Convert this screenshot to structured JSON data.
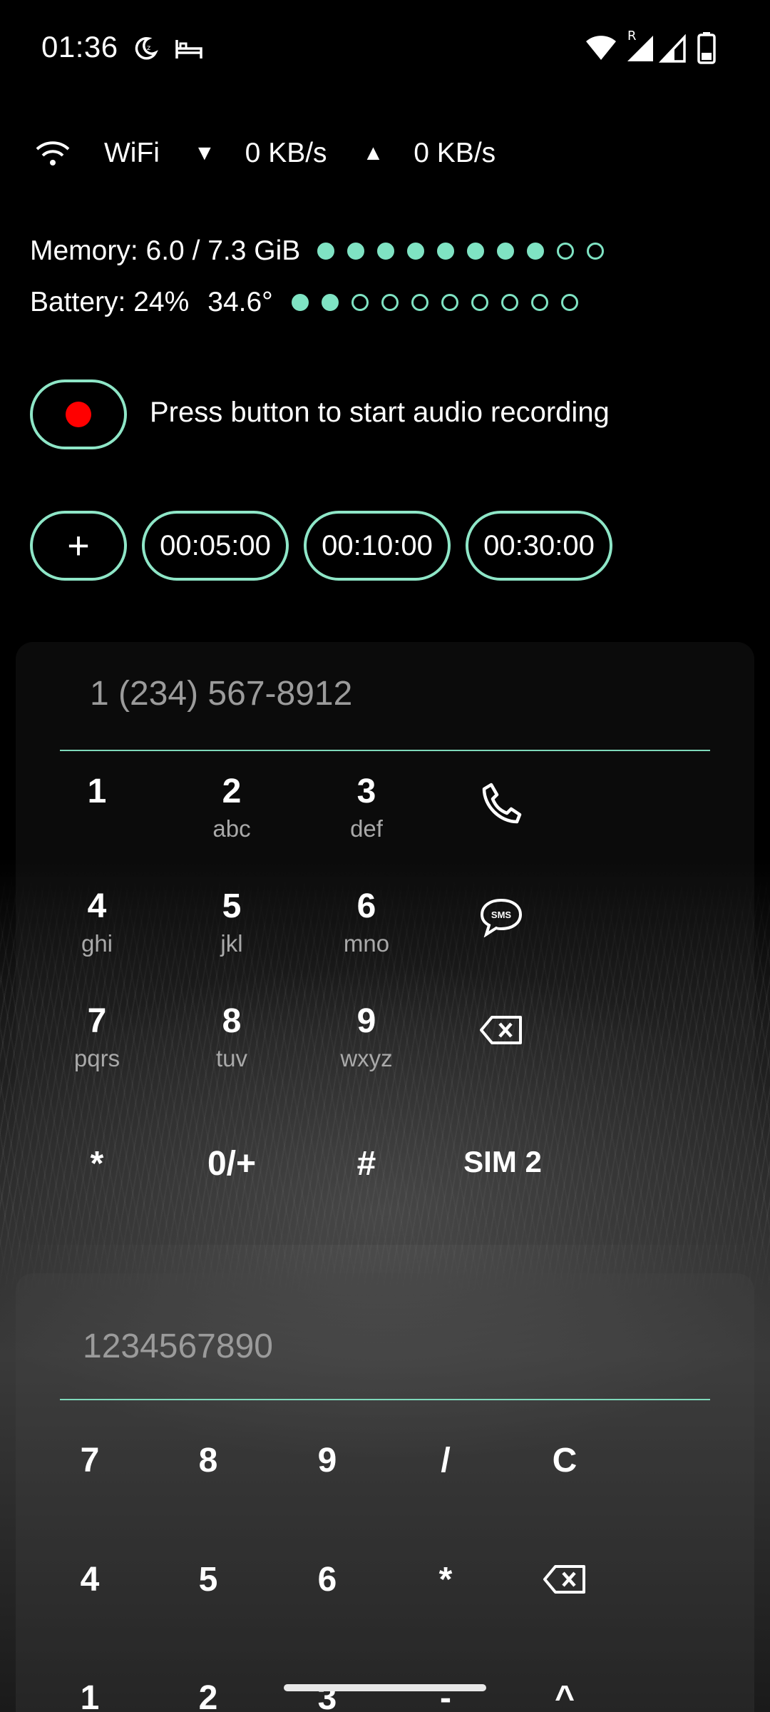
{
  "status_bar": {
    "time": "01:36",
    "roaming_indicator": "R",
    "icons": [
      "do-not-disturb-moon-icon",
      "sleep-bed-icon",
      "wifi-icon",
      "signal-roaming-icon",
      "signal-icon",
      "battery-icon"
    ]
  },
  "network": {
    "label": "WiFi",
    "down_arrow": "▼",
    "down_speed": "0 KB/s",
    "up_arrow": "▲",
    "up_speed": "0 KB/s"
  },
  "memory": {
    "text": "Memory: 6.0 / 7.3 GiB",
    "dots_filled": 8,
    "dots_total": 10
  },
  "battery": {
    "text": "Battery: 24%",
    "temperature": "34.6°",
    "dots_filled": 2,
    "dots_total": 10
  },
  "recorder": {
    "hint": "Press button to start audio recording"
  },
  "timers": {
    "add_label": "+",
    "presets": [
      "00:05:00",
      "00:10:00",
      "00:30:00"
    ]
  },
  "dialer": {
    "placeholder": "1 (234) 567-8912",
    "keys": [
      {
        "digit": "1",
        "letters": ""
      },
      {
        "digit": "2",
        "letters": "abc"
      },
      {
        "digit": "3",
        "letters": "def"
      },
      {
        "digit": "4",
        "letters": "ghi"
      },
      {
        "digit": "5",
        "letters": "jkl"
      },
      {
        "digit": "6",
        "letters": "mno"
      },
      {
        "digit": "7",
        "letters": "pqrs"
      },
      {
        "digit": "8",
        "letters": "tuv"
      },
      {
        "digit": "9",
        "letters": "wxyz"
      },
      {
        "digit": "*",
        "letters": ""
      },
      {
        "digit": "0/+",
        "letters": ""
      },
      {
        "digit": "#",
        "letters": ""
      }
    ],
    "sim_label": "SIM 2",
    "side_icons": [
      "phone-icon",
      "sms-icon",
      "backspace-icon"
    ],
    "sms_text": "SMS"
  },
  "calculator": {
    "placeholder": "1234567890",
    "row1": [
      "7",
      "8",
      "9",
      "/",
      "C"
    ],
    "row2": [
      "4",
      "5",
      "6",
      "*"
    ],
    "row3": [
      "1",
      "2",
      "3",
      "-",
      "^"
    ]
  },
  "colors": {
    "accent": "#8ee6c7",
    "record": "#ff0000",
    "background": "#000000"
  }
}
